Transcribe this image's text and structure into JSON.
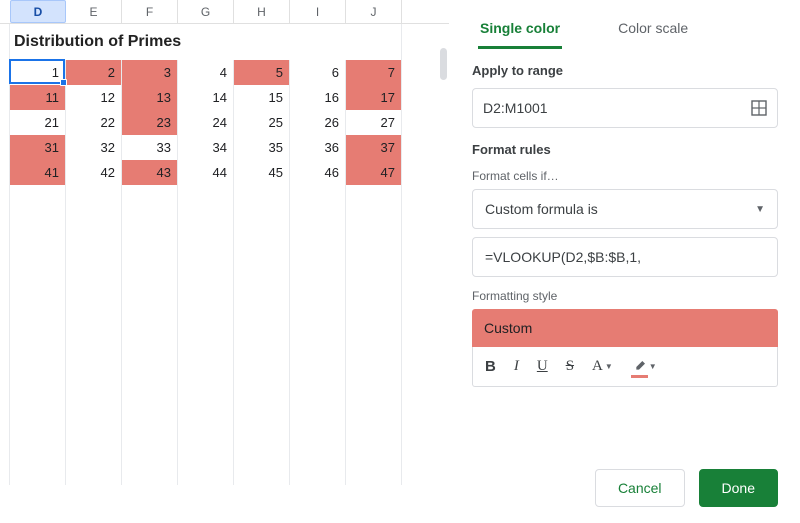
{
  "columns": [
    "D",
    "E",
    "F",
    "G",
    "H",
    "I",
    "J"
  ],
  "active_column": "D",
  "title": "Distribution of Primes",
  "grid": [
    [
      {
        "v": 1,
        "p": false
      },
      {
        "v": 2,
        "p": true
      },
      {
        "v": 3,
        "p": true
      },
      {
        "v": 4,
        "p": false
      },
      {
        "v": 5,
        "p": true
      },
      {
        "v": 6,
        "p": false
      },
      {
        "v": 7,
        "p": true
      }
    ],
    [
      {
        "v": 11,
        "p": true
      },
      {
        "v": 12,
        "p": false
      },
      {
        "v": 13,
        "p": true
      },
      {
        "v": 14,
        "p": false
      },
      {
        "v": 15,
        "p": false
      },
      {
        "v": 16,
        "p": false
      },
      {
        "v": 17,
        "p": true
      }
    ],
    [
      {
        "v": 21,
        "p": false
      },
      {
        "v": 22,
        "p": false
      },
      {
        "v": 23,
        "p": true
      },
      {
        "v": 24,
        "p": false
      },
      {
        "v": 25,
        "p": false
      },
      {
        "v": 26,
        "p": false
      },
      {
        "v": 27,
        "p": false
      }
    ],
    [
      {
        "v": 31,
        "p": true
      },
      {
        "v": 32,
        "p": false
      },
      {
        "v": 33,
        "p": false
      },
      {
        "v": 34,
        "p": false
      },
      {
        "v": 35,
        "p": false
      },
      {
        "v": 36,
        "p": false
      },
      {
        "v": 37,
        "p": true
      }
    ],
    [
      {
        "v": 41,
        "p": true
      },
      {
        "v": 42,
        "p": false
      },
      {
        "v": 43,
        "p": true
      },
      {
        "v": 44,
        "p": false
      },
      {
        "v": 45,
        "p": false
      },
      {
        "v": 46,
        "p": false
      },
      {
        "v": 47,
        "p": true
      }
    ]
  ],
  "selection": {
    "row": 0,
    "col": 0
  },
  "panel": {
    "tabs": {
      "single": "Single color",
      "scale": "Color scale"
    },
    "apply_label": "Apply to range",
    "range": "D2:M1001",
    "rules_label": "Format rules",
    "cells_if_label": "Format cells if…",
    "condition": "Custom formula is",
    "formula": "=VLOOKUP(D2,$B:$B,1,",
    "style_label": "Formatting style",
    "style_name": "Custom",
    "toolbar": {
      "bold": "B",
      "italic": "I",
      "underline": "U",
      "strike": "S",
      "textcolor": "A"
    },
    "cancel": "Cancel",
    "done": "Done"
  }
}
